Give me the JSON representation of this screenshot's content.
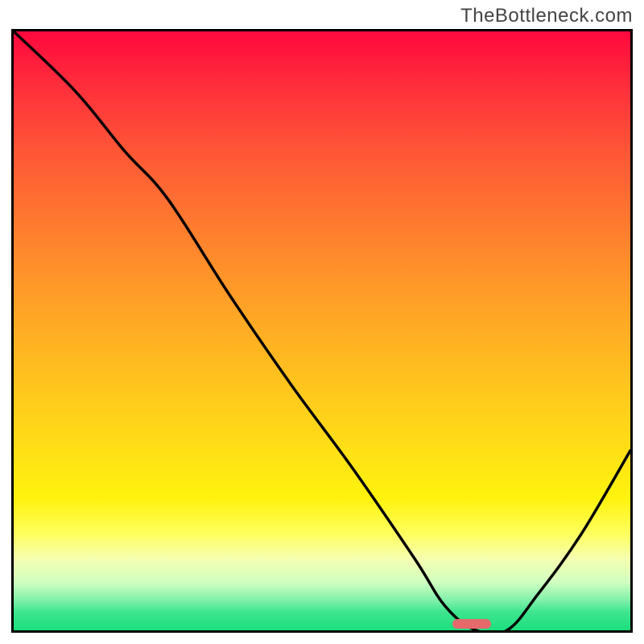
{
  "watermark": "TheBottleneck.com",
  "chart_data": {
    "type": "line",
    "title": "",
    "xlabel": "",
    "ylabel": "",
    "xlim": [
      0,
      100
    ],
    "ylim": [
      0,
      100
    ],
    "background": "vertical rainbow gradient (red top → green bottom)",
    "series": [
      {
        "name": "curve",
        "x": [
          0,
          10,
          18,
          25,
          35,
          45,
          55,
          65,
          70,
          75,
          80,
          85,
          92,
          100
        ],
        "values": [
          100,
          90,
          80,
          72,
          56,
          41,
          27,
          12,
          4,
          0,
          0,
          6,
          16,
          30
        ]
      }
    ],
    "marker": {
      "x_start": 70,
      "x_end": 77,
      "y": 1,
      "color": "#e46a6c"
    }
  }
}
